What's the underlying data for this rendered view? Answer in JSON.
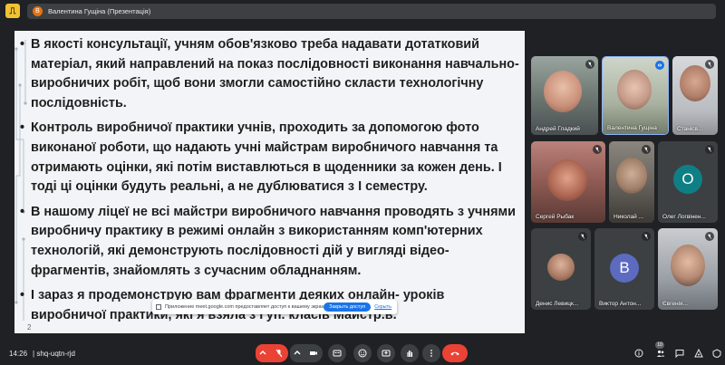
{
  "top_bar": {
    "presenter_initial": "В",
    "presenter_label": "Валентина Гущіна (Презентація)"
  },
  "slide": {
    "bullets": [
      "В якості консультації, учням обов'язково треба надавати дотатковий матеріал, який направлений на показ послідовності виконання навчально-виробничих робіт, щоб вони змогли самостійно скласти технологічну послідовність.",
      "Контроль виробничої практики учнів, проходить за допомогою фото виконаної роботи, що надають учні майстрам виробничого навчання та отримають оцінки, які потім виставлються в щоденники за кожен день. І тоді ці оцінки будуть реальні, а не дублюватися з І семестру.",
      "В нашому ліцеї не всі майстри виробничого навчання проводять з учнями виробничу практику в режимі  онлайн   з використанням комп'ютерних технологій, які демонструють  послідовності дій у вигляді відео-фрагментів, знайомлять з сучасним обладнанням.",
      "І зараз я продемонструю вам фрагменти деяких онлайн- уроків виробничої практики, які я взяла з Гуп. класів Майстр.в."
    ],
    "page_number": "2"
  },
  "share_banner": {
    "text": "Приложение meet.google.com предоставляет доступ к вашему экрану.",
    "stop_label": "Закрыть доступ",
    "hide_label": "Скрыть"
  },
  "participants": [
    {
      "name": "Андрей Гладкий",
      "muted": true
    },
    {
      "name": "Валентина Гущіна",
      "muted": false,
      "speaking": true
    },
    {
      "name": "Станісв...",
      "muted": true
    },
    {
      "name": "Сергей Рыбак",
      "muted": true
    },
    {
      "name": "Николай ...",
      "muted": true
    },
    {
      "name": "Олег Логвінен...",
      "muted": true,
      "initial": "О",
      "color": "#0f7f86"
    },
    {
      "name": "Денис Левицк...",
      "muted": true
    },
    {
      "name": "Виктор Антон...",
      "muted": true,
      "initial": "В",
      "color": "#5c6bc0"
    },
    {
      "name": "Євгенія...",
      "muted": true
    }
  ],
  "bottom_bar": {
    "time": "14:26",
    "separator": "|",
    "meeting_code": "shq-uqtn-rjd",
    "participant_count": "10"
  },
  "colors": {
    "background": "#202124",
    "end_call": "#ea4335",
    "accent": "#1a73e8"
  }
}
